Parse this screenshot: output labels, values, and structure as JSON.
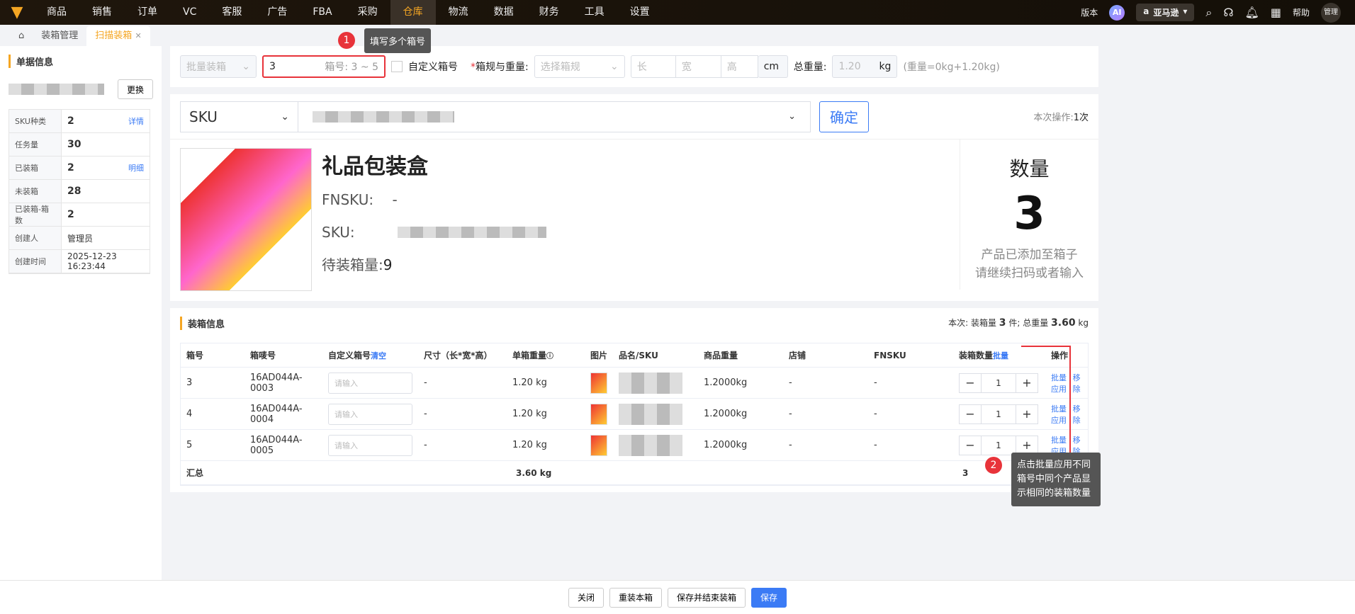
{
  "nav": [
    "商品",
    "销售",
    "订单",
    "VC",
    "客服",
    "广告",
    "FBA",
    "采购",
    "仓库",
    "物流",
    "数据",
    "财务",
    "工具",
    "设置"
  ],
  "nav_active": 8,
  "topright": {
    "version": "版本",
    "ai": "AI",
    "store": "亚马逊",
    "help": "帮助",
    "user": "管理"
  },
  "tabs": {
    "home": "⌂",
    "t1": "装箱管理",
    "t2": "扫描装箱",
    "close": "✕"
  },
  "left": {
    "title": "单据信息",
    "change": "更换",
    "rows": [
      {
        "k": "SKU种类",
        "v": "2",
        "link": "详情"
      },
      {
        "k": "任务量",
        "v": "30"
      },
      {
        "k": "已装箱",
        "v": "2",
        "link": "明细"
      },
      {
        "k": "未装箱",
        "v": "28"
      },
      {
        "k": "已装箱-箱数",
        "v": "2"
      },
      {
        "k": "创建人",
        "v": "管理员"
      },
      {
        "k": "创建时间",
        "v": "2025-12-23 16:23:44"
      }
    ]
  },
  "toolbar": {
    "batch": "批量装箱",
    "box_value": "3",
    "box_hint": "箱号: 3 ~ 5",
    "custom": "自定义箱号",
    "spec_label": "箱规与重量:",
    "spec_ph": "选择箱规",
    "l": "长",
    "w": "宽",
    "h": "高",
    "cm": "cm",
    "total_label": "总重量:",
    "total": "1.20",
    "kg": "kg",
    "formula": "(重量=0kg+1.20kg)"
  },
  "scan": {
    "type": "SKU",
    "confirm": "确定",
    "ops_label": "本次操作:",
    "ops": "1次"
  },
  "product": {
    "name": "礼品包装盒",
    "fnsku_label": "FNSKU:",
    "fnsku": "-",
    "sku_label": "SKU:",
    "pending_label": "待装箱量:",
    "pending": "9",
    "qty_title": "数量",
    "qty": "3",
    "msg1": "产品已添加至箱子",
    "msg2": "请继续扫码或者输入"
  },
  "boxinfo": {
    "title": "装箱信息",
    "summary_pre": "本次: 装箱量",
    "summary_qty": "3",
    "summary_mid": "件; 总重量",
    "summary_w": "3.60",
    "summary_unit": "kg"
  },
  "table": {
    "headers": [
      "箱号",
      "箱唛号",
      "自定义箱号",
      "尺寸（长*宽*高）",
      "单箱重量",
      "图片",
      "品名/SKU",
      "商品重量",
      "店铺",
      "FNSKU",
      "装箱数量",
      "操作"
    ],
    "clear": "清空",
    "batch": "批量",
    "ph": "请输入",
    "rows": [
      {
        "no": "3",
        "mark": "16AD044A-0003",
        "size": "-",
        "w": "1.20 kg",
        "pw": "1.2000kg",
        "shop": "-",
        "fnsku": "-",
        "qty": "1"
      },
      {
        "no": "4",
        "mark": "16AD044A-0004",
        "size": "-",
        "w": "1.20 kg",
        "pw": "1.2000kg",
        "shop": "-",
        "fnsku": "-",
        "qty": "1"
      },
      {
        "no": "5",
        "mark": "16AD044A-0005",
        "size": "-",
        "w": "1.20 kg",
        "pw": "1.2000kg",
        "shop": "-",
        "fnsku": "-",
        "qty": "1"
      }
    ],
    "apply": "批量应用",
    "remove": "移除",
    "total_label": "汇总",
    "total_w": "3.60 kg",
    "total_qty": "3"
  },
  "tips": {
    "b1": "1",
    "t1": "填写多个箱号",
    "b2": "2",
    "t2": "点击批量应用不同箱号中同个产品显示相同的装箱数量"
  },
  "footer": [
    "关闭",
    "重装本箱",
    "保存并结束装箱",
    "保存"
  ]
}
